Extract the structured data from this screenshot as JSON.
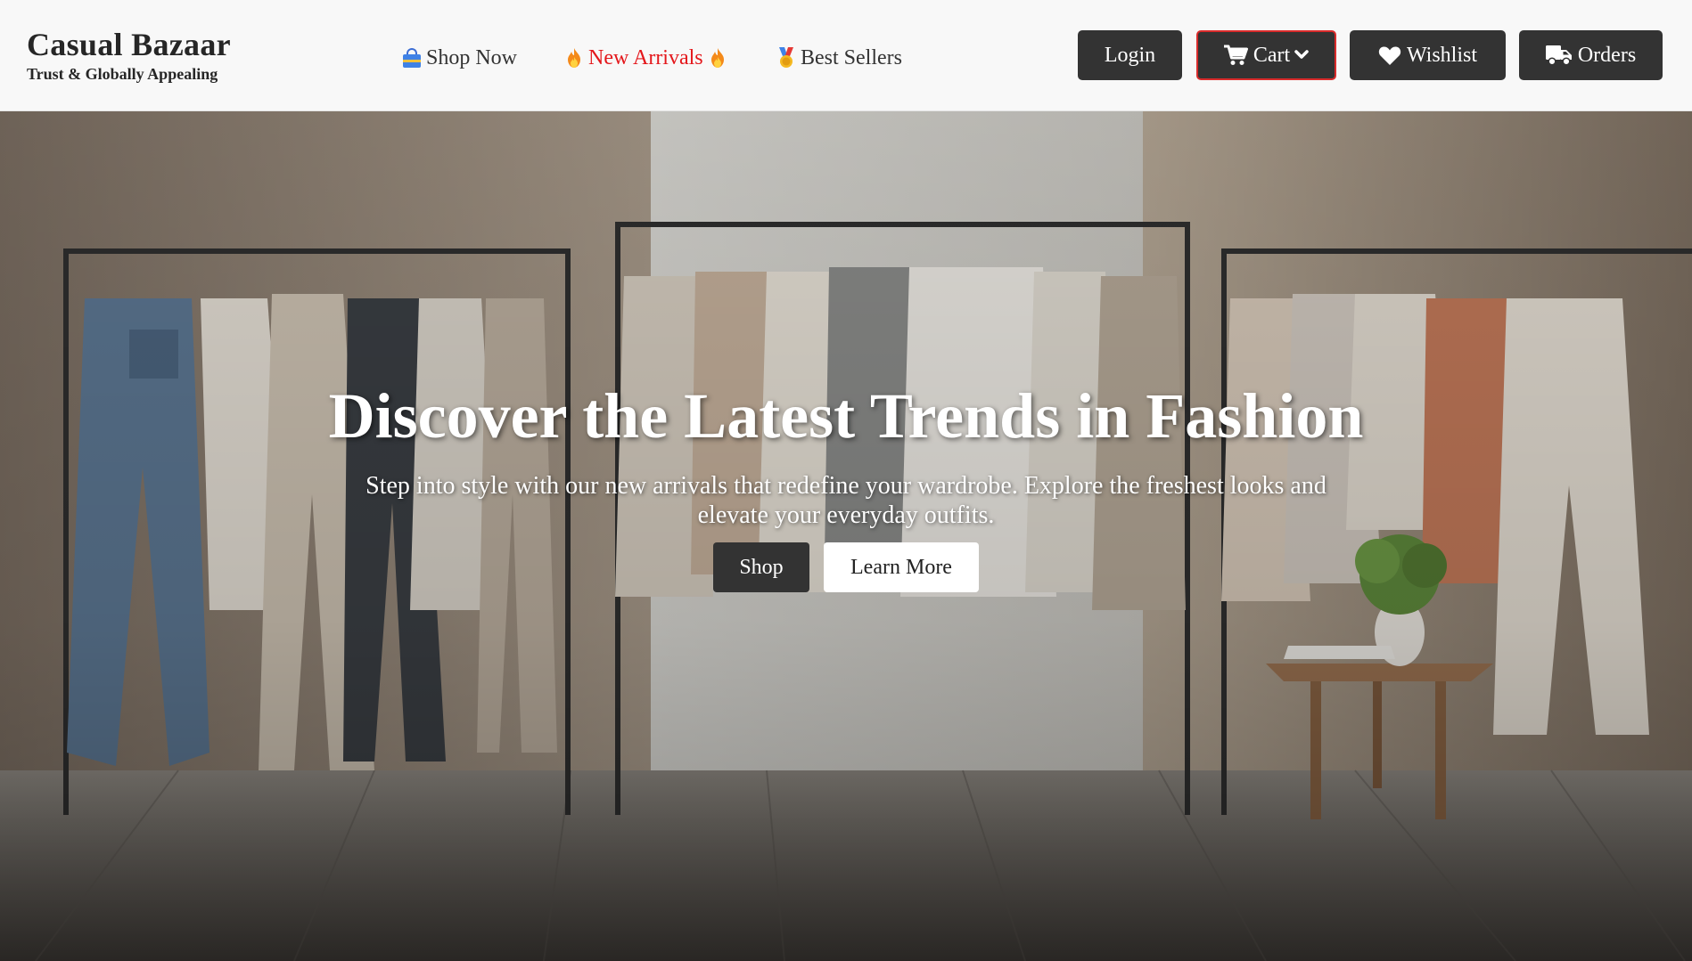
{
  "brand": {
    "name": "Casual Bazaar",
    "tagline": "Trust & Globally Appealing"
  },
  "nav": {
    "items": [
      {
        "label": "Shop Now",
        "icon": "shopping-bag-icon"
      },
      {
        "label": "New Arrivals",
        "icon": "fire-icon",
        "color": "#e4171b"
      },
      {
        "label": "Best Sellers",
        "icon": "medal-icon"
      }
    ]
  },
  "header_buttons": {
    "login": {
      "label": "Login"
    },
    "cart": {
      "label": "Cart",
      "icon": "cart-icon",
      "caret": "chevron-down-icon",
      "border_color": "#d92b2b"
    },
    "wishlist": {
      "label": "Wishlist",
      "icon": "heart-icon"
    },
    "orders": {
      "label": "Orders",
      "icon": "truck-icon"
    }
  },
  "hero": {
    "title": "Discover the Latest Trends in Fashion",
    "subtitle": "Step into style with our new arrivals that redefine your wardrobe. Explore the freshest looks and elevate your everyday outfits.",
    "primary_button": "Shop",
    "secondary_button": "Learn More"
  },
  "colors": {
    "header_bg": "#f8f8f8",
    "button_dark": "#333333",
    "accent_red": "#e4171b"
  }
}
